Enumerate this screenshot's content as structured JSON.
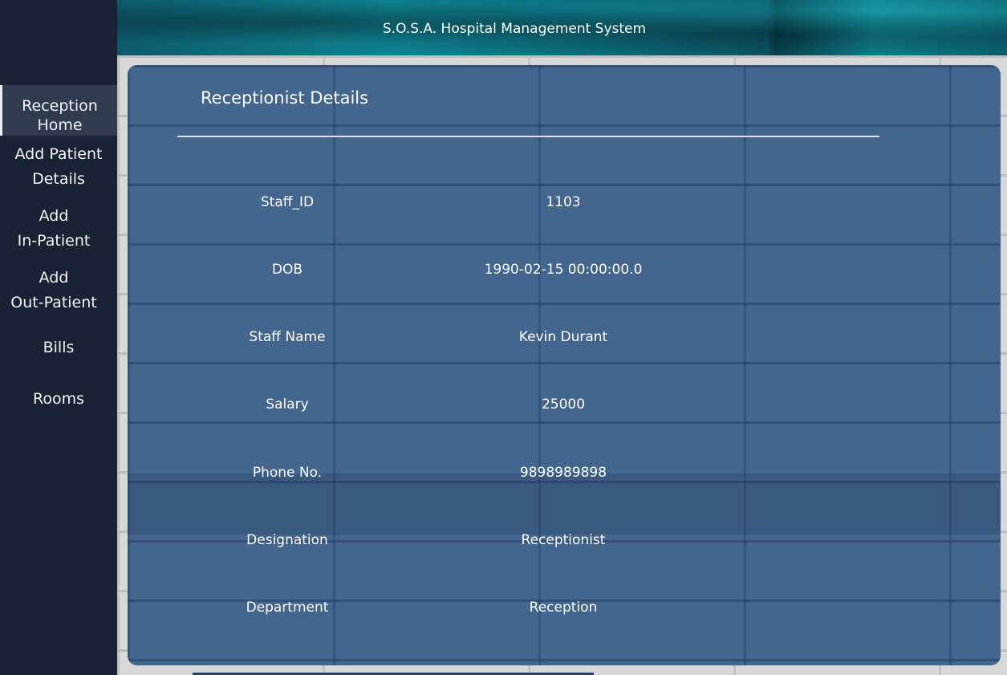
{
  "header": {
    "title": "S.O.S.A. Hospital Management System"
  },
  "sidebar": {
    "items": [
      {
        "line1": "Reception",
        "line2": "Home",
        "active": true
      },
      {
        "line1": "Add Patient",
        "line2": "Details",
        "active": false
      },
      {
        "line1": "Add",
        "line2": "In-Patient",
        "active": false
      },
      {
        "line1": "Add",
        "line2": "Out-Patient",
        "active": false
      },
      {
        "line1": "Bills",
        "line2": "",
        "active": false
      },
      {
        "line1": "Rooms",
        "line2": "",
        "active": false
      }
    ]
  },
  "main": {
    "title": "Receptionist Details",
    "rows": [
      {
        "label": "Staff_ID",
        "value": "1103"
      },
      {
        "label": "DOB",
        "value": "1990-02-15 00:00:00.0"
      },
      {
        "label": "Staff Name",
        "value": "Kevin Durant"
      },
      {
        "label": "Salary",
        "value": "25000"
      },
      {
        "label": "Phone No.",
        "value": "9898989898"
      },
      {
        "label": "Designation",
        "value": "Receptionist"
      },
      {
        "label": "Department",
        "value": "Reception"
      }
    ]
  },
  "colors": {
    "sidebar_bg": "#1a2333",
    "card_bg": "#43668f",
    "header_teal": "#0f7f8e",
    "text": "#ffffff"
  }
}
